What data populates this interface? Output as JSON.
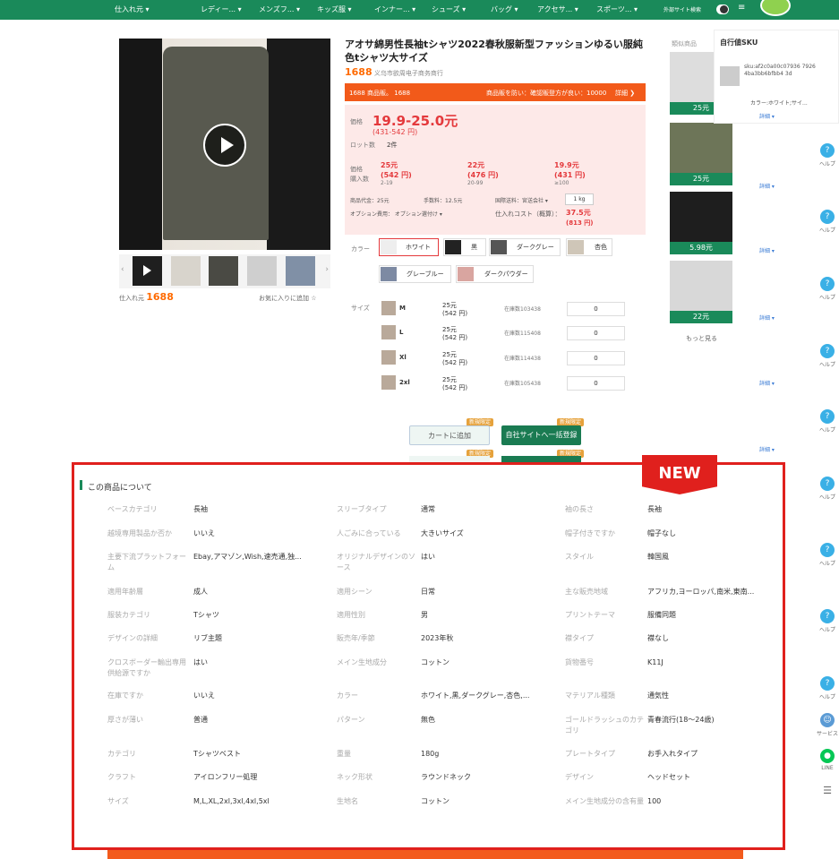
{
  "nav": {
    "items": [
      "仕入れ元 ▾",
      "レディー... ▾",
      "メンズフ... ▾",
      "キッズ服 ▾",
      "インナー... ▾",
      "シューズ ▾",
      "バッグ ▾",
      "アクセサ... ▾",
      "スポーツ... ▾",
      "外部サイト検索"
    ],
    "menu_icon": "≡"
  },
  "product": {
    "title": "アオサ綿男性長袖tシャツ2022春秋服新型ファッションゆるい服純色tシャツ大サイズ",
    "shop_logo": "1688",
    "shop_name": "义乌市欲周电子商务商行",
    "source_label": "仕入れ元",
    "source_logo": "1688",
    "favorite": "お気に入りに追加 ☆"
  },
  "banner": {
    "left": "1688 商品販。 1688",
    "middle": "商品販を防い：確認販登方が良い：10000",
    "right": "詳細 ❯"
  },
  "price": {
    "label": "価格",
    "range": "19.9-25.0元",
    "range_jpy": "(431-542 円)",
    "lot_label": "ロット数",
    "lot_value": "2件",
    "tier_label1": "価格",
    "tier_label2": "購入数",
    "tiers": [
      {
        "cny": "25元",
        "jpy": "(542 円)",
        "qty": "2-19"
      },
      {
        "cny": "22元",
        "jpy": "(476 円)",
        "qty": "20-99"
      },
      {
        "cny": "19.9元",
        "jpy": "(431 円)",
        "qty": "≥100"
      }
    ],
    "commission": "商品代金：25元",
    "fee": "手数料：12.5元",
    "domestic": "国際送料：宮送会社 ▾",
    "weight": "1 kg",
    "option_fee": "オプション費用： オプション選付け ▾",
    "cost_label": "仕入れコスト（概算）：",
    "cost_value": "37.5元",
    "cost_jpy": "(813 円)"
  },
  "colors": {
    "label": "カラー",
    "options": [
      "ホワイト",
      "黒",
      "ダークグレー",
      "杏色",
      "グレーブルー",
      "ダークパウダー"
    ]
  },
  "sizes": {
    "label": "サイズ",
    "rows": [
      {
        "size": "M",
        "price": "25元",
        "jpy": "(542 円)",
        "stock": "在庫数103438",
        "qty": "0"
      },
      {
        "size": "L",
        "price": "25元",
        "jpy": "(542 円)",
        "stock": "在庫数115408",
        "qty": "0"
      },
      {
        "size": "Xl",
        "price": "25元",
        "jpy": "(542 円)",
        "stock": "在庫数114438",
        "qty": "0"
      },
      {
        "size": "2xl",
        "price": "25元",
        "jpy": "(542 円)",
        "stock": "在庫数105438",
        "qty": "0"
      }
    ]
  },
  "buttons": {
    "cart": "カートに追加",
    "order": "自社サイトへ一括登録",
    "badge": "新規限定"
  },
  "recommend": {
    "title": "類似商品",
    "prices": [
      "25元",
      "25元",
      "5.98元",
      "22元"
    ],
    "more": "もっと見る",
    "detail": "詳細 ▾"
  },
  "sku": {
    "title": "自行値SKU",
    "code": "sku:af2c0a00c07936 79264ba3bb6bfbb4 3d",
    "desc": "カラー:ホワイト;サイ...",
    "detail": "詳細 ▾"
  },
  "help_label": "ヘルプ",
  "side_service": "サービス",
  "side_line": "LINE",
  "new_tag": "NEW",
  "about": {
    "title": "この商品について",
    "rows": [
      [
        [
          "ベースカテゴリ",
          "長袖"
        ],
        [
          "スリーブタイプ",
          "通常"
        ],
        [
          "袖の長さ",
          "長袖"
        ]
      ],
      [
        [
          "越境専用製品か否か",
          "いいえ"
        ],
        [
          "人ごみに合っている",
          "大きいサイズ"
        ],
        [
          "帽子付きですか",
          "帽子なし"
        ]
      ],
      [
        [
          "主要下流プラットフォーム",
          "Ebay,アマゾン,Wish,速売通,独..."
        ],
        [
          "オリジナルデザインのソース",
          "はい"
        ],
        [
          "スタイル",
          "韓国風"
        ]
      ],
      [
        [
          "適用年齢層",
          "成人"
        ],
        [
          "適用シーン",
          "日常"
        ],
        [
          "主な販売地域",
          "アフリカ,ヨーロッパ,南米,東南..."
        ]
      ],
      [
        [
          "服装カテゴリ",
          "Tシャツ"
        ],
        [
          "適用性別",
          "男"
        ],
        [
          "プリントテーマ",
          "服備同題"
        ]
      ],
      [
        [
          "デザインの詳細",
          "リブ主題"
        ],
        [
          "販売年/季節",
          "2023年秋"
        ],
        [
          "襟タイプ",
          "襟なし"
        ]
      ],
      [
        [
          "クロスボーダー輸出専用供給源ですか",
          "はい"
        ],
        [
          "メイン生地成分",
          "コットン"
        ],
        [
          "貨物番号",
          "K11J"
        ]
      ],
      [
        [
          "在庫ですか",
          "いいえ"
        ],
        [
          "カラー",
          "ホワイト,黒,ダークグレー,杏色,..."
        ],
        [
          "マテリアル種類",
          "通気性"
        ]
      ],
      [
        [
          "厚さが薄い",
          "普通"
        ],
        [
          "パターン",
          "無色"
        ],
        [
          "ゴールドラッシュのカテゴリ",
          "青春流行(18～24歳)"
        ]
      ],
      [
        [
          "カテゴリ",
          "Tシャツベスト"
        ],
        [
          "重量",
          "180g"
        ],
        [
          "プレートタイプ",
          "お手入れタイプ"
        ]
      ],
      [
        [
          "クラフト",
          "アイロンフリー処理"
        ],
        [
          "ネック形状",
          "ラウンドネック"
        ],
        [
          "デザイン",
          "ヘッドセット"
        ]
      ],
      [
        [
          "サイズ",
          "M,L,XL,2xl,3xl,4xl,5xl"
        ],
        [
          "生地名",
          "コットン"
        ],
        [
          "メイン生地成分の含有量",
          "100"
        ]
      ]
    ]
  },
  "accent": "#1a8a5a",
  "highlight_color": "#e0201d"
}
